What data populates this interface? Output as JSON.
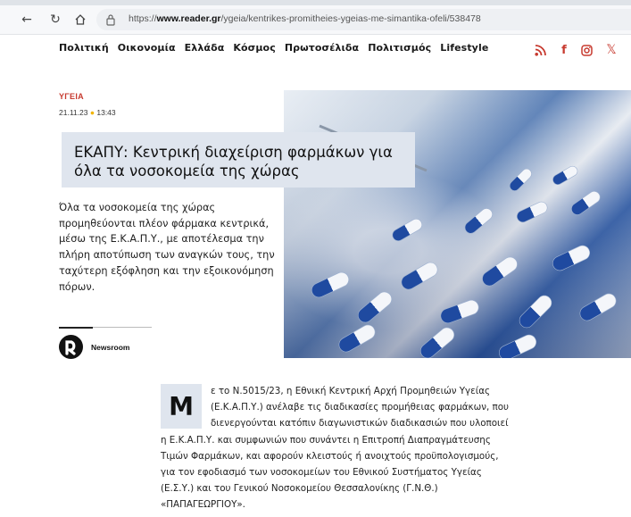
{
  "browser": {
    "url_prefix": "https://",
    "url_domain": "www.reader.gr",
    "url_path": "/ygeia/kentrikes-promitheies-ygeias-me-simantika-ofeli/538478",
    "back_icon": "back-arrow-icon",
    "reload_icon": "reload-icon",
    "home_icon": "home-icon"
  },
  "nav": {
    "items": [
      "Πολιτική",
      "Οικονομία",
      "Ελλάδα",
      "Κόσμος",
      "Πρωτοσέλιδα",
      "Πολιτισμός",
      "Lifestyle"
    ]
  },
  "social": [
    "rss-icon",
    "facebook-icon",
    "instagram-icon",
    "x-icon"
  ],
  "article": {
    "category": "ΥΓΕΙΑ",
    "date": "21.11.23",
    "time": "13:43",
    "title": "ΕΚΑΠΥ: Κεντρική διαχείριση φαρμάκων για όλα τα νοσοκομεία της χώρας",
    "lead": "Όλα τα νοσοκομεία της χώρας προμηθεύονται πλέον φάρμακα κεντρικά, μέσω της Ε.Κ.Α.Π.Υ., με αποτέλεσμα την πλήρη αποτύπωση των αναγκών τους, την ταχύτερη εξόφληση και την εξοικονόμηση πόρων.",
    "author": "Newsroom",
    "dropcap": "Μ",
    "body_lines": [
      "ε το Ν.5015/23, η Εθνική Κεντρική Αρχή Προμηθειών Υγείας",
      "(Ε.Κ.Α.Π.Υ.) ανέλαβε τις διαδικασίες προμήθειας φαρμάκων, που",
      "διενεργούνται κατόπιν διαγωνιστικών διαδικασιών που υλοποιεί",
      "η Ε.Κ.Α.Π.Υ. και συμφωνιών που συνάντει η Επιτροπή Διαπραγμάτευσης",
      "Τιμών Φαρμάκων, και αφορούν κλειστούς ή ανοιχτούς προϋπολογισμούς,",
      "για τον εφοδιασμό των νοσοκομείων του Εθνικού Συστήματος Υγείας",
      "(Ε.Σ.Υ.) και του Γενικού Νοσοκομείου Θεσσαλονίκης (Γ.Ν.Θ.)",
      "«ΠΑΠΑΓΕΩΡΓΙΟΥ»."
    ]
  },
  "colors": {
    "accent": "#c73a2f",
    "title_bg": "#dfe5ee",
    "date_dot": "#f2b400"
  }
}
